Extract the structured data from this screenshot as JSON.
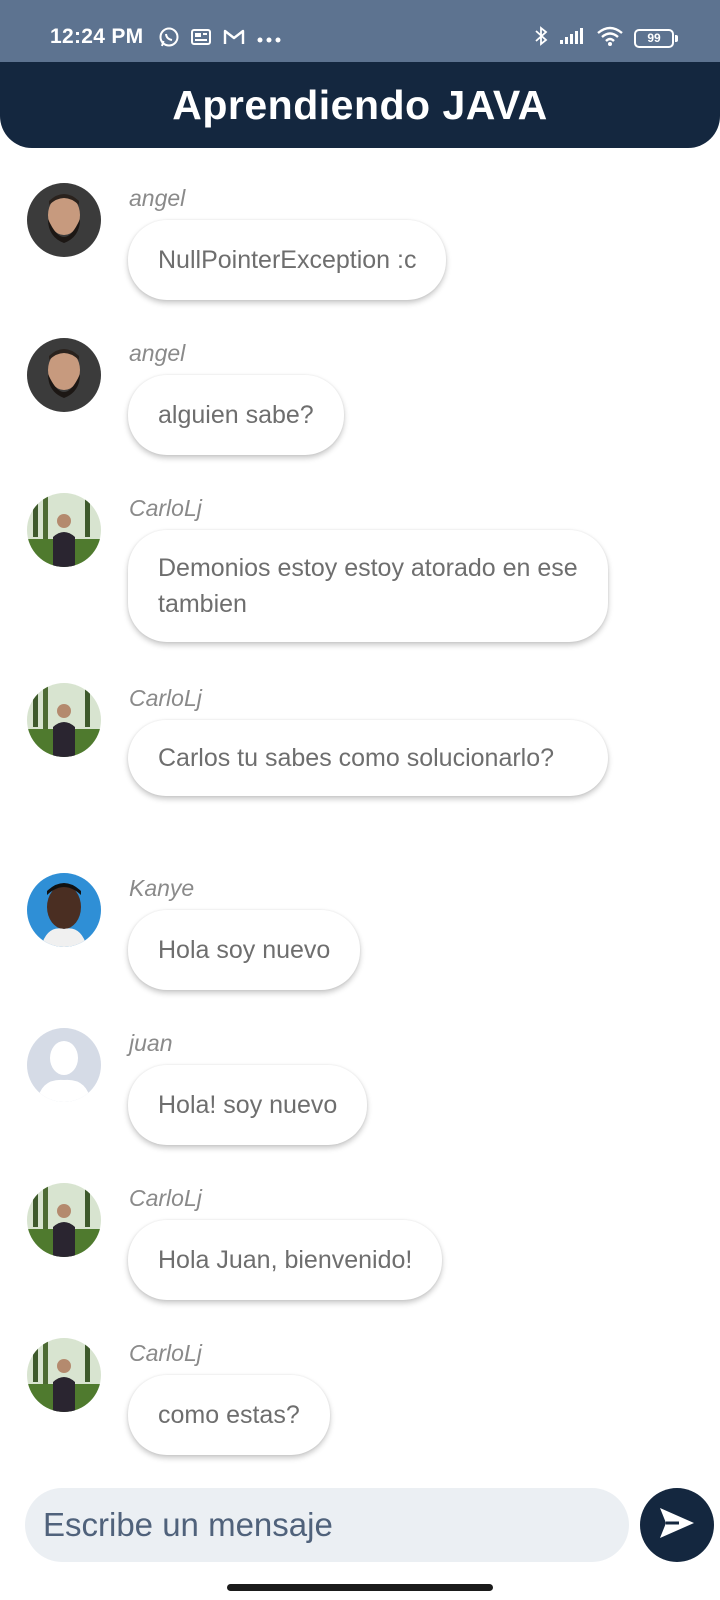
{
  "status_bar": {
    "time": "12:24 PM",
    "battery": "99",
    "icons": [
      "whatsapp-icon",
      "news-icon",
      "gmail-icon",
      "more-dots-icon",
      "bluetooth-icon",
      "signal-icon",
      "wifi-icon",
      "battery-icon"
    ]
  },
  "header": {
    "title": "Aprendiendo JAVA"
  },
  "messages": [
    {
      "sender": "angel",
      "text": "NullPointerException :c",
      "avatar": "bearded-man-avatar"
    },
    {
      "sender": "angel",
      "text": "alguien sabe?",
      "avatar": "bearded-man-avatar"
    },
    {
      "sender": "CarloLj",
      "text": "Demonios estoy estoy atorado en ese tambien",
      "avatar": "man-in-suit-garden-avatar"
    },
    {
      "sender": "CarloLj",
      "text": "Carlos tu sabes como solucionarlo?",
      "avatar": "man-in-suit-garden-avatar"
    },
    {
      "sender": "Kanye",
      "text": "Hola soy nuevo",
      "avatar": "kanye-avatar"
    },
    {
      "sender": "juan",
      "text": "Hola! soy nuevo",
      "avatar": "default-user-avatar"
    },
    {
      "sender": "CarloLj",
      "text": "Hola Juan, bienvenido!",
      "avatar": "man-in-suit-garden-avatar"
    },
    {
      "sender": "CarloLj",
      "text": "como estas?",
      "avatar": "man-in-suit-garden-avatar"
    }
  ],
  "composer": {
    "placeholder": "Escribe un mensaje",
    "value": ""
  },
  "colors": {
    "status_bar": "#5d7390",
    "header": "#14273f",
    "bubble_text": "#6e6e6e",
    "composer_bg": "#ebeff3",
    "send_button": "#14273f"
  }
}
